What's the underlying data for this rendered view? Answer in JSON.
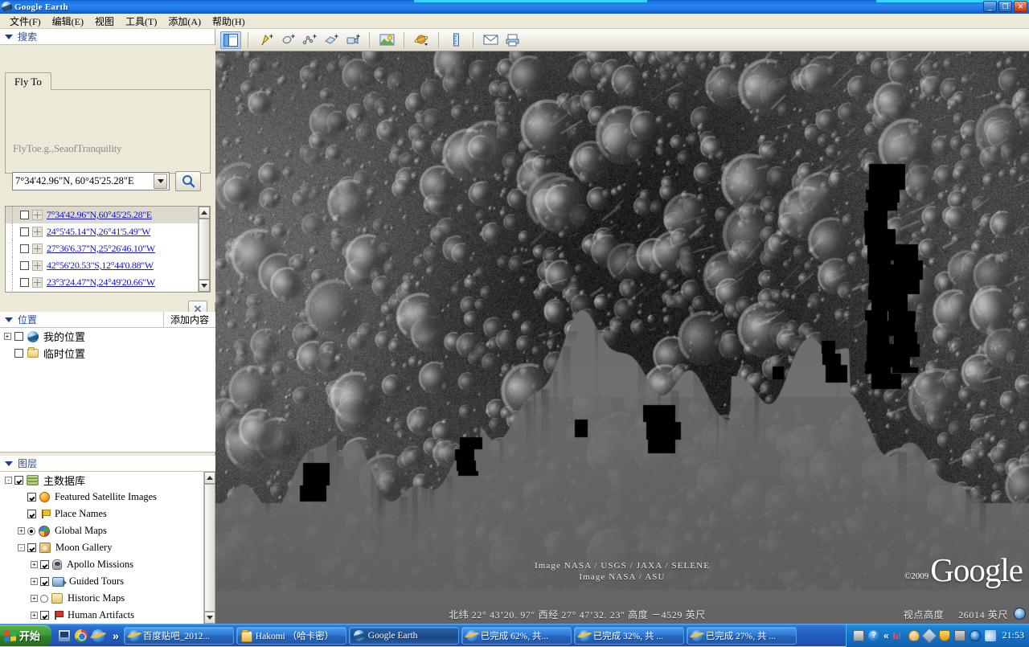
{
  "window": {
    "title": "Google Earth",
    "minimize_label": "_",
    "maximize_label": "❐",
    "close_label": "✕"
  },
  "menu": {
    "items": [
      {
        "label": "文件(F)",
        "name": "menu-file"
      },
      {
        "label": "编辑(E)",
        "name": "menu-edit"
      },
      {
        "label": "视图",
        "name": "menu-view"
      },
      {
        "label": "工具(T)",
        "name": "menu-tools"
      },
      {
        "label": "添加(A)",
        "name": "menu-add"
      },
      {
        "label": "帮助(H)",
        "name": "menu-help"
      }
    ]
  },
  "toolbar": {
    "buttons": [
      {
        "name": "toggle-sidebar-icon",
        "title": "隐藏边栏"
      },
      {
        "name": "add-placemark-icon",
        "title": "添加地标"
      },
      {
        "name": "add-polygon-icon",
        "title": "添加多边形"
      },
      {
        "name": "add-path-icon",
        "title": "添加路径"
      },
      {
        "name": "add-image-overlay-icon",
        "title": "添加图像叠加层"
      },
      {
        "name": "record-tour-icon",
        "title": "录制游览"
      },
      {
        "name": "historical-imagery-icon",
        "title": "显示阳光"
      },
      {
        "name": "switch-planet-icon",
        "title": "在天空、火星和月球之间切换"
      },
      {
        "name": "ruler-icon",
        "title": "显示标尺"
      },
      {
        "name": "email-icon",
        "title": "电子邮件"
      },
      {
        "name": "print-icon",
        "title": "打印"
      }
    ]
  },
  "search": {
    "header": "搜索",
    "tab_label": "Fly To",
    "hint": "FlyToe.g.,SeaofTranquility",
    "input_value": "7°34'42.96\"N, 60°45'25.28\"E",
    "go_icon": "search-icon",
    "close_label": "✕",
    "results": [
      {
        "label": "7°34'42.96\"N,60°45'25.28\"E",
        "selected": true
      },
      {
        "label": "24°5'45.14\"N,26°41'5.49\"W",
        "selected": false
      },
      {
        "label": "27°36'6.37\"N,25°26'46.10\"W",
        "selected": false
      },
      {
        "label": "42°56'20.53\"S,12°44'0.88\"W",
        "selected": false
      },
      {
        "label": "23°3'24.47\"N,24°49'20.66\"W",
        "selected": false
      }
    ]
  },
  "places": {
    "header": "位置",
    "add_content_label": "添加内容",
    "items": [
      {
        "label": "我的位置",
        "icon": "earth-icon",
        "checked": false,
        "expander": "+"
      },
      {
        "label": "临时位置",
        "icon": "folder-icon",
        "checked": false,
        "expander": ""
      }
    ]
  },
  "layers": {
    "header": "图层",
    "items": [
      {
        "label": "主数据库",
        "icon": "layers-stack-icon",
        "checked": true,
        "control": "check",
        "expander": "-",
        "indent": 0
      },
      {
        "label": "Featured Satellite Images",
        "icon": "orange-dot-icon",
        "checked": true,
        "control": "check",
        "expander": "",
        "indent": 1
      },
      {
        "label": "Place Names",
        "icon": "flag-icon",
        "checked": true,
        "control": "check",
        "expander": "",
        "indent": 1
      },
      {
        "label": "Global Maps",
        "icon": "globe-icon",
        "checked": true,
        "control": "radio",
        "expander": "+",
        "indent": 1
      },
      {
        "label": "Moon Gallery",
        "icon": "moon-icon",
        "checked": true,
        "control": "check",
        "expander": "-",
        "indent": 1
      },
      {
        "label": "Apollo Missions",
        "icon": "astronaut-icon",
        "checked": true,
        "control": "check",
        "expander": "+",
        "indent": 2
      },
      {
        "label": "Guided Tours",
        "icon": "camera-icon",
        "checked": true,
        "control": "check",
        "expander": "+",
        "indent": 2
      },
      {
        "label": "Historic Maps",
        "icon": "scroll-icon",
        "checked": false,
        "control": "radio",
        "expander": "+",
        "indent": 2
      },
      {
        "label": "Human Artifacts",
        "icon": "red-flag-icon",
        "checked": true,
        "control": "check",
        "expander": "+",
        "indent": 2
      }
    ]
  },
  "map": {
    "credits_line1": "Image  NASA  /  USGS  /  JAXA  /  SELENE",
    "credits_line2": "Image  NASA  /  ASU",
    "watermark_copyright": "©2009",
    "watermark_text": "Google",
    "status_coords": "北纬 22° 43’20. 97″   西经  27° 47’32. 23″  高度 －4529 英尺",
    "status_eye_label": "视点高度",
    "status_eye_value": "26014  英尺"
  },
  "taskbar": {
    "start_label": "开始",
    "overflow_label": "»",
    "quick_launch": [
      {
        "name": "show-desktop-icon"
      },
      {
        "name": "chrome-icon"
      },
      {
        "name": "internet-explorer-icon"
      }
    ],
    "tasks": [
      {
        "label": "百度贴吧_2012...",
        "icon": "internet-explorer-icon",
        "active": false
      },
      {
        "label": "Hakomi （哈卡密）",
        "icon": "folder-icon",
        "active": false
      },
      {
        "label": "Google Earth",
        "icon": "google-earth-icon",
        "active": true
      },
      {
        "label": "已完成 62%, 共...",
        "icon": "internet-explorer-icon",
        "active": false
      },
      {
        "label": "已完成 32%, 共 ...",
        "icon": "internet-explorer-icon",
        "active": false
      },
      {
        "label": "已完成 27%, 共 ...",
        "icon": "internet-explorer-icon",
        "active": false
      }
    ],
    "tray_icons": [
      {
        "name": "keyboard-icon"
      },
      {
        "name": "help-icon"
      },
      {
        "name": "expand-tray-icon"
      },
      {
        "name": "h-red-icon"
      },
      {
        "name": "user-account-icon"
      },
      {
        "name": "pen-icon"
      },
      {
        "name": "shield-icon"
      },
      {
        "name": "trash-icon"
      },
      {
        "name": "network-icon"
      },
      {
        "name": "volume-icon"
      }
    ],
    "clock": "21:53"
  },
  "colors": {
    "titlebar_blue": "#1b73df",
    "accent_cyan": "#36d5ff",
    "link_blue": "#1414cf",
    "panel_bg": "#ece9d8",
    "moon_grey": "#6e6e6e"
  }
}
